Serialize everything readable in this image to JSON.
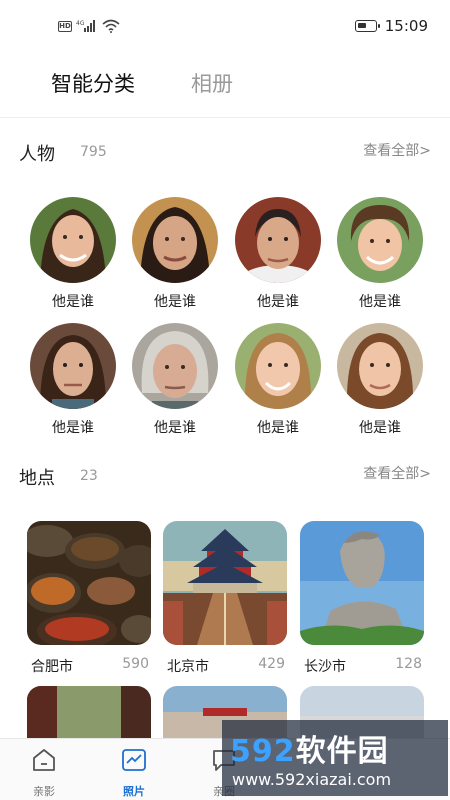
{
  "status": {
    "time": "15:09",
    "hd": "HD",
    "net": "4G"
  },
  "tabs": [
    {
      "label": "智能分类",
      "active": true
    },
    {
      "label": "相册",
      "active": false
    }
  ],
  "people": {
    "title": "人物",
    "count": "795",
    "view_all": "查看全部>",
    "items": [
      {
        "label": "他是谁"
      },
      {
        "label": "他是谁"
      },
      {
        "label": "他是谁"
      },
      {
        "label": "他是谁"
      },
      {
        "label": "他是谁"
      },
      {
        "label": "他是谁"
      },
      {
        "label": "他是谁"
      },
      {
        "label": "他是谁"
      }
    ]
  },
  "places": {
    "title": "地点",
    "count": "23",
    "view_all": "查看全部>",
    "items": [
      {
        "name": "合肥市",
        "count": "590"
      },
      {
        "name": "北京市",
        "count": "429"
      },
      {
        "name": "长沙市",
        "count": "128"
      }
    ]
  },
  "bottom_nav": [
    {
      "label": "亲影",
      "active": false
    },
    {
      "label": "照片",
      "active": true
    },
    {
      "label": "亲圈",
      "active": false
    }
  ],
  "watermark": {
    "brand_num": "592",
    "brand_text": "软件园",
    "url": "www.592xiazai.com"
  }
}
